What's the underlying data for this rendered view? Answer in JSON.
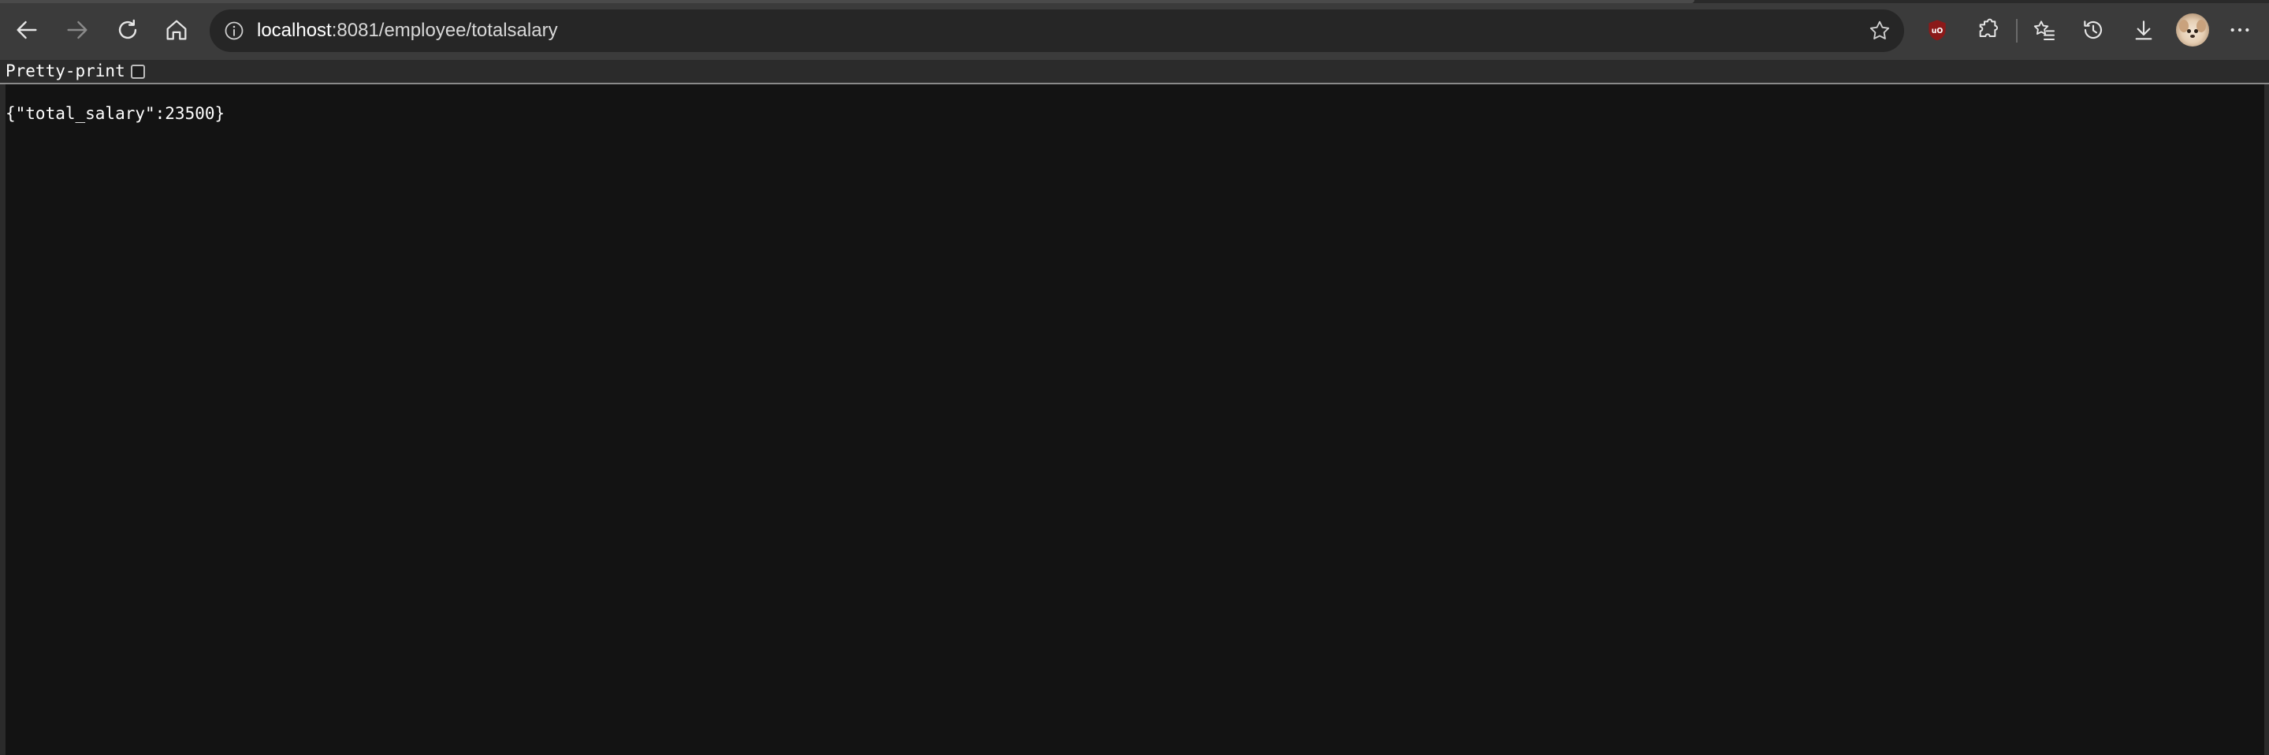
{
  "browser": {
    "address_bar": {
      "url_host": "localhost",
      "url_rest": ":8081/employee/totalsalary"
    },
    "toolbar_icons": [
      "back-arrow-icon",
      "forward-arrow-icon",
      "refresh-icon",
      "home-icon",
      "site-info-icon",
      "favorite-star-icon",
      "ublock-origin-icon",
      "extensions-puzzle-icon",
      "favorites-list-icon",
      "history-icon",
      "downloads-icon",
      "profile-avatar",
      "more-menu-icon"
    ],
    "colors": {
      "toolbar_bg": "#3b3b3b",
      "addressbar_bg": "#262626",
      "page_bg": "#131313",
      "ublock_red": "#8b1a1a"
    }
  },
  "viewer": {
    "pretty_print_label": "Pretty-print",
    "pretty_print_checked": false,
    "json_text": "{\"total_salary\":23500}"
  }
}
